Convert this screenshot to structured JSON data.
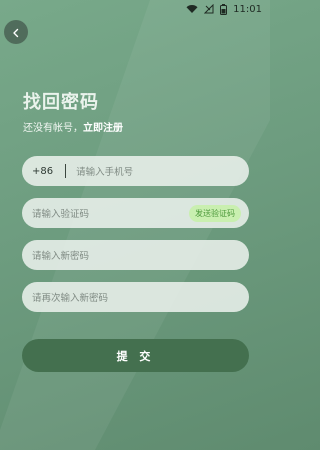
{
  "status_bar": {
    "time": "11:01",
    "icons": [
      "wifi-icon",
      "signal-off-icon",
      "battery-icon"
    ]
  },
  "header": {
    "back_icon": "back-arrow-icon",
    "title": "找回密码",
    "subtitle_text": "还没有帐号，",
    "register_link": "立即注册"
  },
  "form": {
    "phone": {
      "prefix": "+86",
      "placeholder": "请输入手机号"
    },
    "code": {
      "placeholder": "请输入验证码",
      "send_button": "发送验证码"
    },
    "new_password": {
      "placeholder": "请输入新密码"
    },
    "confirm_password": {
      "placeholder": "请再次输入新密码"
    },
    "submit_label": "提 交"
  },
  "colors": {
    "background": "#6d9c7f",
    "submit_button": "#44704f",
    "field_background": "#ecf2ed",
    "code_button_background": "#c9efb0",
    "code_button_text": "#4e9a3c"
  }
}
